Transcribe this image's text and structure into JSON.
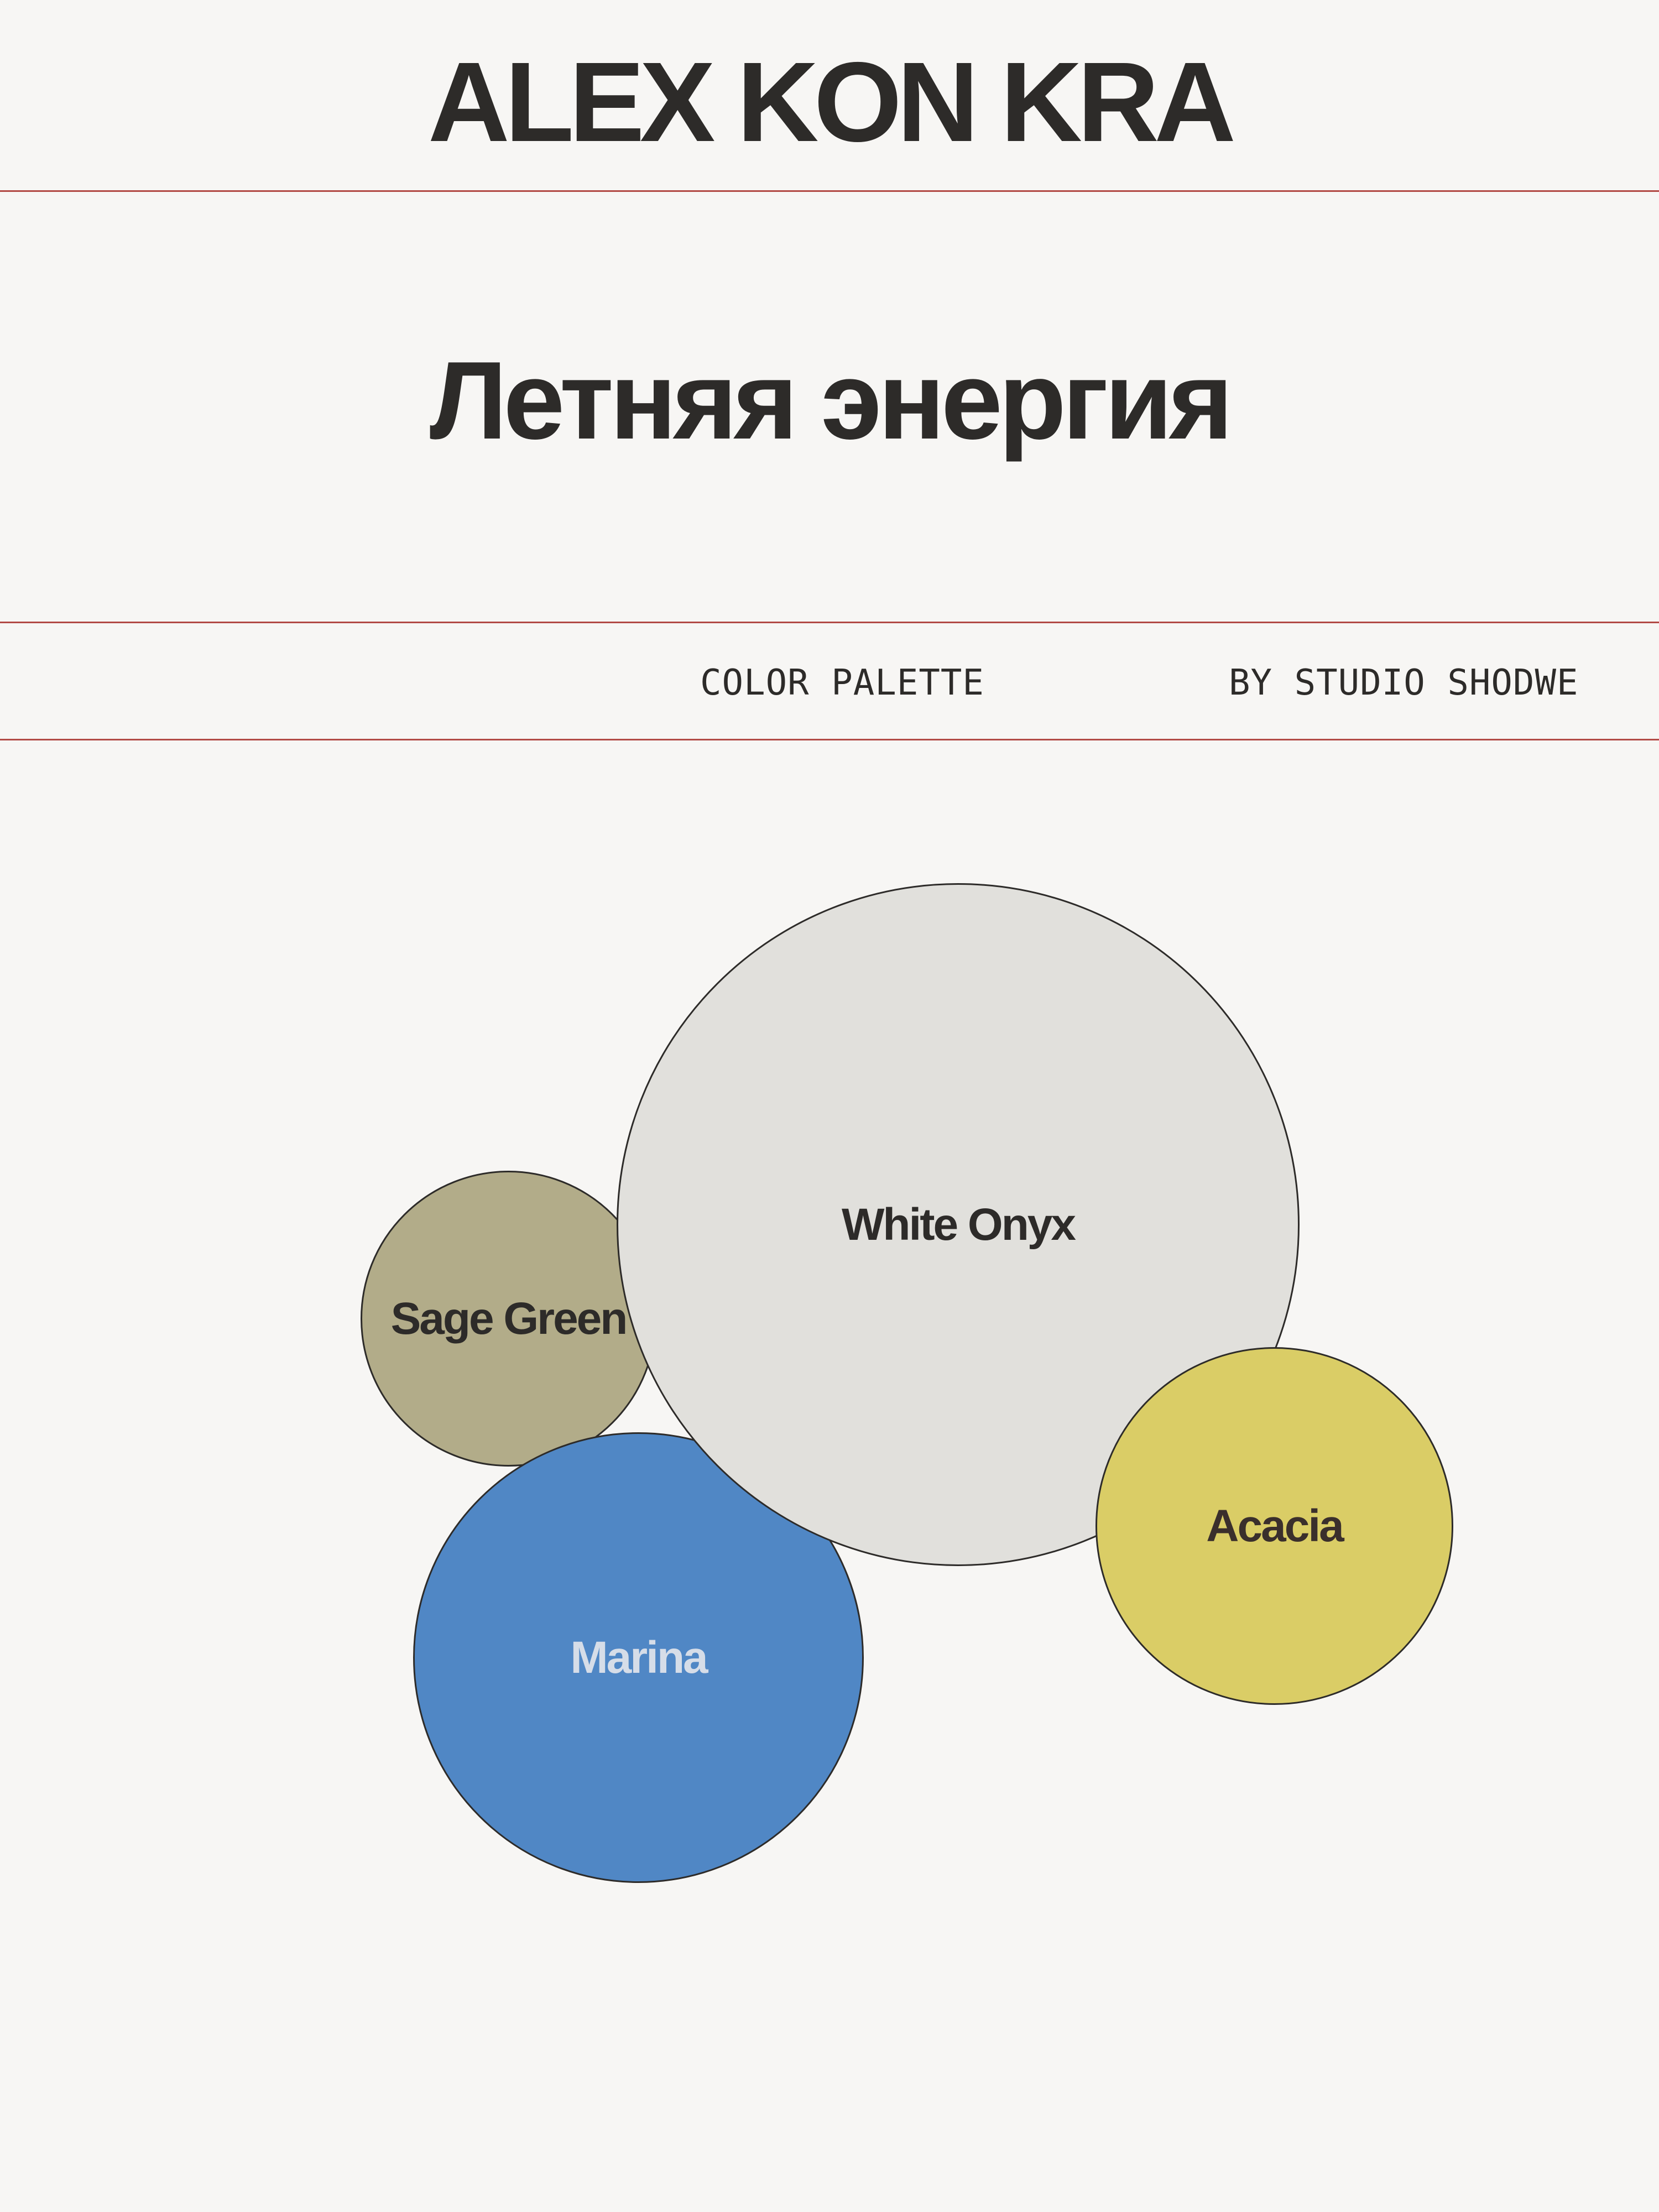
{
  "header": {
    "brand": "ALEX KON KRA",
    "title": "Летняя энергия"
  },
  "meta": {
    "palette_label": "COLOR PALETTE",
    "studio_label": "BY STUDIO SHODWE"
  },
  "colors": {
    "background": "#f7f6f4",
    "text": "#2d2b29",
    "rule": "#b24a45"
  },
  "palette": [
    {
      "key": "sage",
      "name": "Sage Green",
      "color": "#b2ac89",
      "label_color": "#2d2b29"
    },
    {
      "key": "onyx",
      "name": "White Onyx",
      "color": "#e1e0dc",
      "label_color": "#2d2b29"
    },
    {
      "key": "marina",
      "name": "Marina",
      "color": "#5087c5",
      "label_color": "#d6dde8"
    },
    {
      "key": "acacia",
      "name": "Acacia",
      "color": "#dacd66",
      "label_color": "#3a2f2c"
    }
  ]
}
